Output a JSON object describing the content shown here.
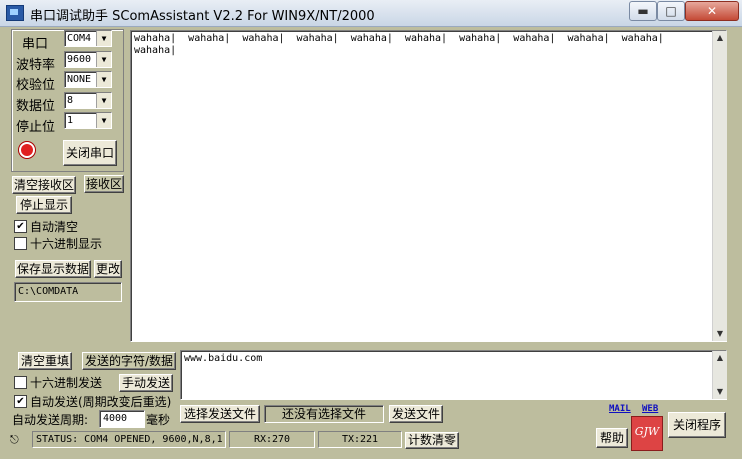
{
  "window": {
    "title": "串口调试助手 SComAssistant V2.2 For WIN9X/NT/2000",
    "min_icon": "minimize-icon",
    "max_icon": "maximize-icon",
    "close_icon": "close-icon"
  },
  "port_settings": {
    "port_label": "串口",
    "port_value": "COM4",
    "baud_label": "波特率",
    "baud_value": "9600",
    "parity_label": "校验位",
    "parity_value": "NONE",
    "databits_label": "数据位",
    "databits_value": "8",
    "stopbits_label": "停止位",
    "stopbits_value": "1",
    "status_led_color": "#e02020",
    "close_port_button": "关闭串口"
  },
  "receive": {
    "clear_button": "清空接收区",
    "area_label": "接收区",
    "stop_display_button": "停止显示",
    "auto_clear_label": "自动清空",
    "auto_clear_checked": true,
    "hex_display_label": "十六进制显示",
    "hex_display_checked": false,
    "save_button": "保存显示数据",
    "change_button": "更改",
    "save_path": "C:\\COMDATA",
    "text_lines": [
      "wahaha|  wahaha|  wahaha|  wahaha|  wahaha|  wahaha|  wahaha|  wahaha|  wahaha|  wahaha|",
      "wahaha|"
    ]
  },
  "send": {
    "clear_button": "清空重填",
    "area_label": "发送的字符/数据",
    "hex_send_label": "十六进制发送",
    "hex_send_checked": false,
    "manual_send_button": "手动发送",
    "auto_send_label": "自动发送(周期改变后重选)",
    "auto_send_checked": true,
    "period_label": "自动发送周期:",
    "period_value": "4000",
    "period_unit": "毫秒",
    "select_file_button": "选择发送文件",
    "file_status": "还没有选择文件",
    "send_file_button": "发送文件",
    "text": "www.baidu.com"
  },
  "links": {
    "mail": "MAIL",
    "web": "WEB",
    "logo_text": "GJW",
    "help_button": "帮助",
    "exit_button": "关闭程序"
  },
  "status_bar": {
    "status_text": "STATUS: COM4 OPENED, 9600,N,8,1",
    "rx_text": "RX:270",
    "tx_text": "TX:221",
    "reset_count_button": "计数清零"
  }
}
